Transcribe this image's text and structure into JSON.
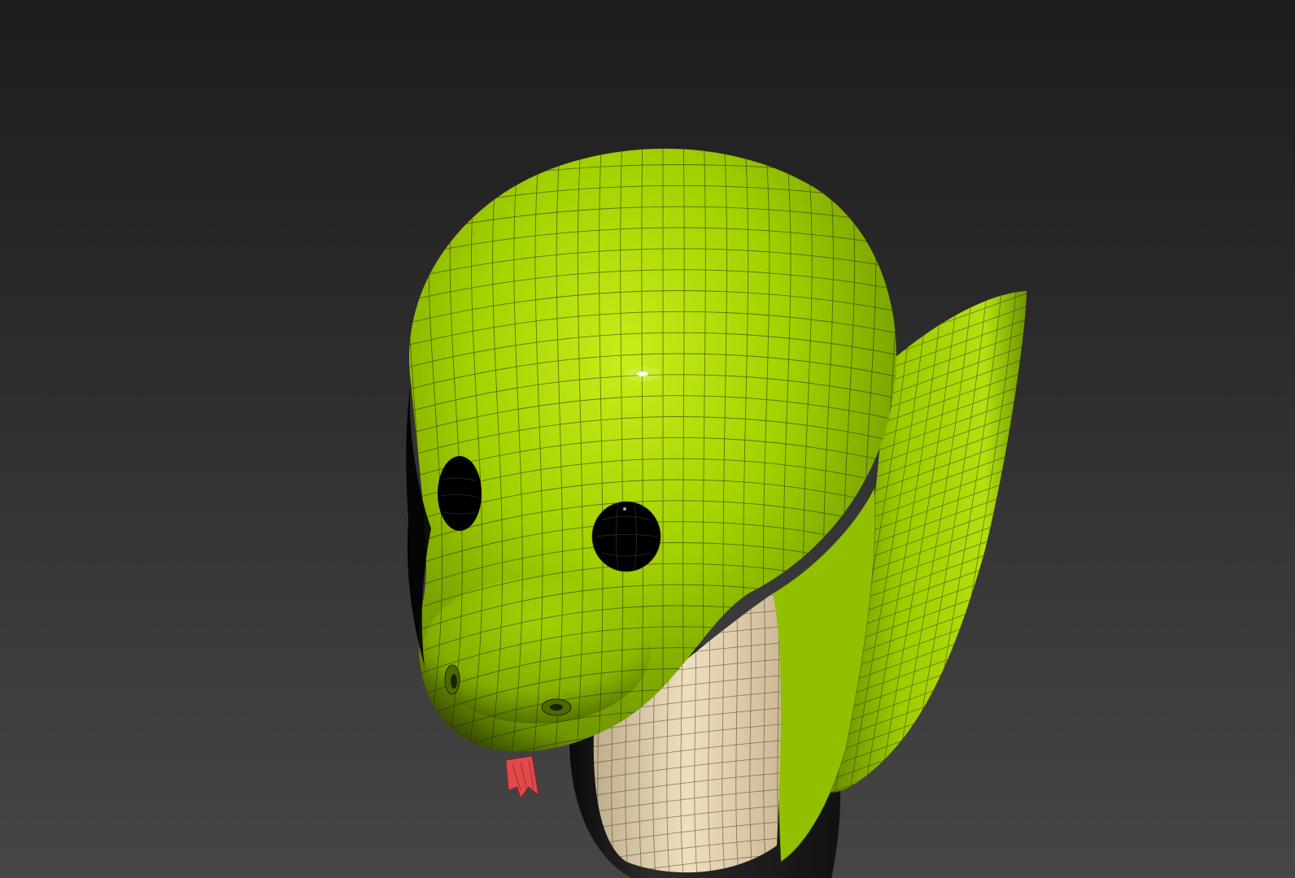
{
  "viewport": {
    "background_top": "#1d1d1d",
    "background_bottom": "#464646"
  },
  "model": {
    "body_color": "#a6d400",
    "belly_color": "#e8d7b4",
    "tongue_color": "#e04a4a",
    "eye_color": "#000000",
    "wire_color": "#1a1a1a"
  }
}
